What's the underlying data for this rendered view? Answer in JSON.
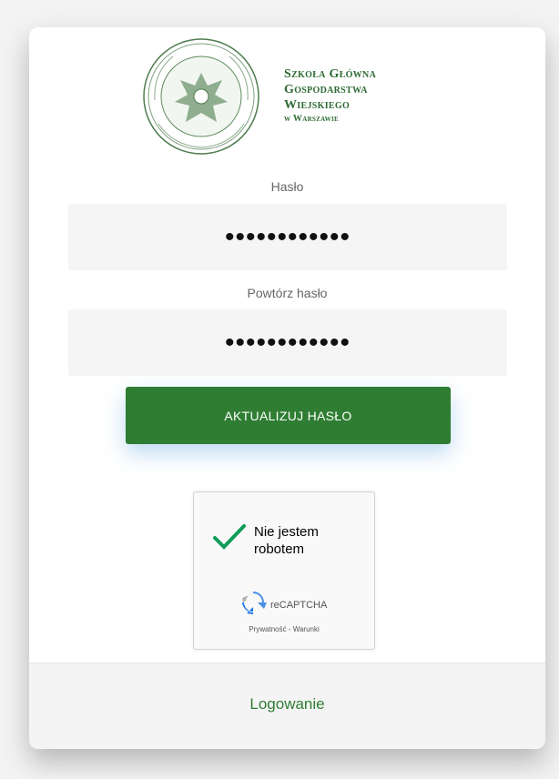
{
  "logo": {
    "line1": "Szkoła Główna",
    "line2": "Gospodarstwa",
    "line3": "Wiejskiego",
    "line4": "w Warszawie"
  },
  "form": {
    "password_label": "Hasło",
    "password_value": "••••••••••••",
    "repeat_label": "Powtórz hasło",
    "repeat_value": "••••••••••••",
    "submit_label": "AKTUALIZUJ HASŁO"
  },
  "captcha": {
    "text_line1": "Nie jestem",
    "text_line2": "robotem",
    "brand": "reCAPTCHA",
    "links": "Prywatność - Warunki",
    "checked": true
  },
  "footer": {
    "login_link": "Logowanie"
  },
  "colors": {
    "brand_green": "#2e7d32",
    "captcha_check": "#0f9d58"
  }
}
